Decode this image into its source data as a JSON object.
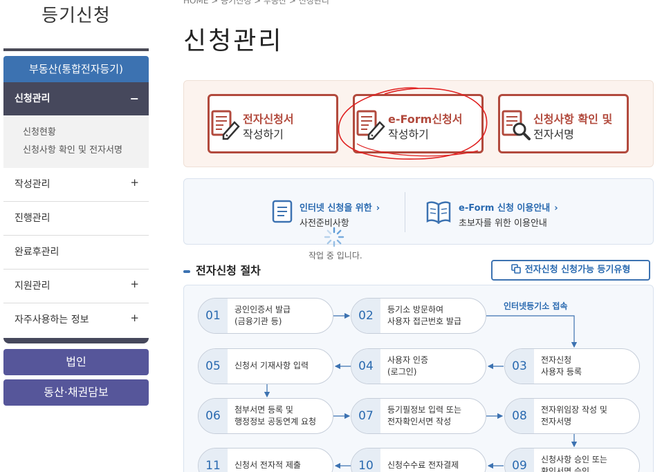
{
  "sidebar": {
    "title": "등기신청",
    "realty_tab": "부동산(통합전자등기)",
    "active_menu": {
      "label": "신청관리",
      "toggle": "−"
    },
    "submenu": [
      "신청현황",
      "신청사항 확인 및 전자서명"
    ],
    "menu_items": [
      {
        "label": "작성관리",
        "toggle": "+"
      },
      {
        "label": "진행관리",
        "toggle": ""
      },
      {
        "label": "완료후관리",
        "toggle": ""
      },
      {
        "label": "지원관리",
        "toggle": "+"
      },
      {
        "label": "자주사용하는 정보",
        "toggle": "+"
      }
    ],
    "corp_button": "법인",
    "movable_button": "동산·채권담보"
  },
  "breadcrumb": "HOME > 등기신청 > 부동산 > 신청관리",
  "page_title": "신청관리",
  "apply_cards": [
    {
      "line1": "전자신청서",
      "line2": "작성하기"
    },
    {
      "line1": "e-Form신청서",
      "line2": "작성하기"
    },
    {
      "line1": "신청사항 확인 및",
      "line2": "전자서명"
    }
  ],
  "info_links": [
    {
      "line1": "인터넷 신청을 위한",
      "line2": "사전준비사항"
    },
    {
      "line1": "e-Form 신청 이용안내",
      "line2": "초보자를 위한 이용안내"
    }
  ],
  "loading_text": "작업 중 입니다.",
  "section_title": "전자신청 절차",
  "types_button": "전자신청 신청가능 등기유형",
  "internet_note": "인터넷등기소 접속",
  "steps": [
    {
      "num": "01",
      "line1": "공인인증서 발급",
      "line2": "(금융기관 등)"
    },
    {
      "num": "02",
      "line1": "등기소 방문하여",
      "line2": "사용자 접근번호 발급"
    },
    {
      "num": "03",
      "line1": "전자신청",
      "line2": "사용자 등록"
    },
    {
      "num": "04",
      "line1": "사용자 인증",
      "line2": "(로그인)"
    },
    {
      "num": "05",
      "line1": "신청서 기재사항 입력",
      "line2": ""
    },
    {
      "num": "06",
      "line1": "첨부서면 등록 및",
      "line2": "행정정보 공동연계 요청"
    },
    {
      "num": "07",
      "line1": "등기필정보 입력 또는",
      "line2": "전자확인서면 작성"
    },
    {
      "num": "08",
      "line1": "전자위임장 작성 및",
      "line2": "전자서명"
    },
    {
      "num": "09",
      "line1": "신청사항 승인 또는",
      "line2": "확인서명 승인"
    },
    {
      "num": "10",
      "line1": "신청수수료 전자결제",
      "line2": ""
    },
    {
      "num": "11",
      "line1": "신청서 전자적 제출",
      "line2": ""
    }
  ],
  "colors": {
    "navy": "#46485c",
    "blue": "#3c72b1",
    "purple": "#56569a",
    "brick": "#b24a3d"
  }
}
